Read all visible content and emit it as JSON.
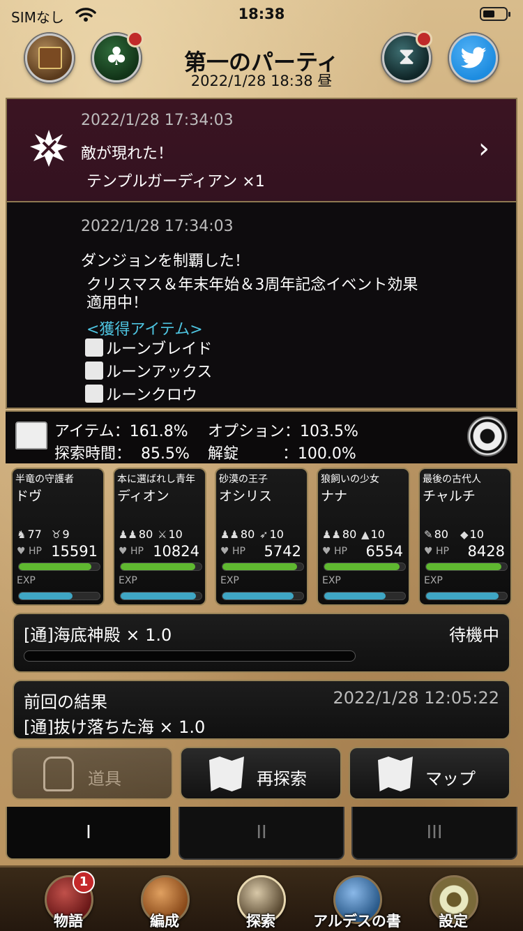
{
  "status_bar": {
    "carrier": "SIMなし",
    "time": "18:38"
  },
  "header": {
    "title": "第一のパーティ",
    "datetime": "2022/1/28  18:38 昼"
  },
  "log": [
    {
      "time": "2022/1/28  17:34:03",
      "lines": [
        "敵が現れた！",
        "テンプルガーディアン  ×1"
      ]
    },
    {
      "time": "2022/1/28  17:34:03",
      "lines": [
        "ダンジョンを制覇した！",
        "クリスマス＆年末年始＆3周年記念イベント効果",
        "適用中！"
      ],
      "items_header": "<獲得アイテム>",
      "items": [
        "ルーンブレイド",
        "ルーンアックス",
        "ルーンクロウ"
      ]
    }
  ],
  "options": {
    "item_label": "アイテム：161.8%",
    "option_label": "オプション：103.5%",
    "search_label": "探索時間：  85.5%",
    "unlock_label": "解錠         ：100.0%"
  },
  "party": [
    {
      "title": "半竜の守護者",
      "name": "ドヴ",
      "stat1": "77",
      "stat2": "9",
      "hp": "15591",
      "hp_ratio": 0.9,
      "exp_ratio": 0.66
    },
    {
      "title": "本に選ばれし青年",
      "name": "ディオン",
      "stat1": "80",
      "stat2": "10",
      "hp": "10824",
      "hp_ratio": 0.92,
      "exp_ratio": 0.93
    },
    {
      "title": "砂漠の王子",
      "name": "オシリス",
      "stat1": "80",
      "stat2": "10",
      "hp": "5742",
      "hp_ratio": 0.92,
      "exp_ratio": 0.88
    },
    {
      "title": "狼飼いの少女",
      "name": "ナナ",
      "stat1": "80",
      "stat2": "10",
      "hp": "6554",
      "hp_ratio": 0.93,
      "exp_ratio": 0.76
    },
    {
      "title": "最後の古代人",
      "name": "チャルチ",
      "stat1": "80",
      "stat2": "10",
      "hp": "8428",
      "hp_ratio": 0.93,
      "exp_ratio": 0.9
    }
  ],
  "current_mission": {
    "name": "[通]海底神殿  × 1.0",
    "status": "待機中"
  },
  "previous_result": {
    "title": "前回の結果",
    "datetime": "2022/1/28  12:05:22",
    "mission": "[通]抜け落ちた海  × 1.0"
  },
  "actions": {
    "items": "道具",
    "re_explore": "再探索",
    "map": "マップ"
  },
  "party_tabs": [
    "I",
    "II",
    "III"
  ],
  "nav": {
    "story": "物語",
    "story_badge": "1",
    "formation": "編成",
    "explore": "探索",
    "book": "アルデスの書",
    "settings": "設定"
  },
  "colors": {
    "hp_bar": "#5fb830",
    "exp_bar": "#3fa6c4",
    "accent_border": "#9a8458",
    "items_header": "#4ec4e0"
  }
}
